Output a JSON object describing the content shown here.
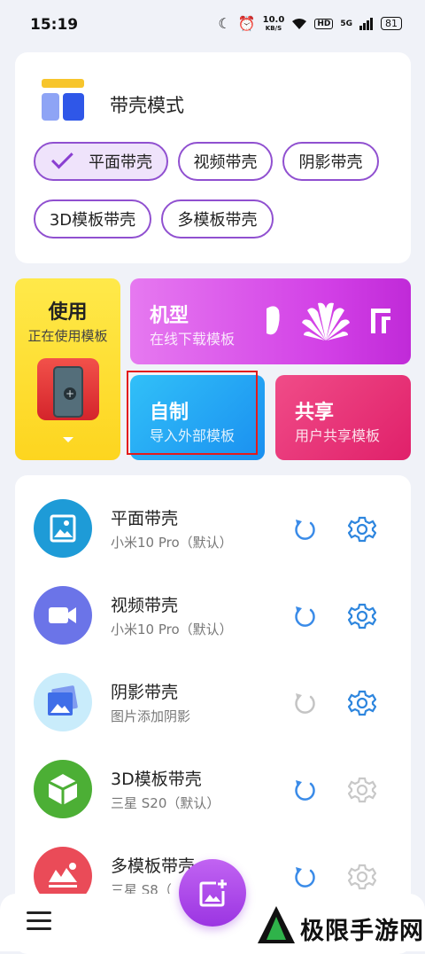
{
  "status_bar": {
    "time": "15:19",
    "network_speed": "10.0",
    "network_unit": "KB/S",
    "hd": "HD",
    "signal": "5G",
    "battery": "81",
    "icons": [
      "moon-icon",
      "alarm-icon",
      "wifi-icon",
      "signal-icon",
      "battery-icon"
    ]
  },
  "mode_card": {
    "title": "带壳模式",
    "chips": [
      {
        "label": "平面带壳",
        "selected": true
      },
      {
        "label": "视频带壳",
        "selected": false
      },
      {
        "label": "阴影带壳",
        "selected": false
      },
      {
        "label": "3D模板带壳",
        "selected": false
      },
      {
        "label": "多模板带壳",
        "selected": false
      }
    ]
  },
  "tiles": {
    "use": {
      "title": "使用",
      "subtitle": "正在使用模板"
    },
    "model": {
      "title": "机型",
      "subtitle": "在线下载模板",
      "brands": [
        "apple-logo-icon",
        "huawei-logo-icon",
        "xiaomi-logo-icon"
      ]
    },
    "self_made": {
      "title": "自制",
      "subtitle": "导入外部模板"
    },
    "share": {
      "title": "共享",
      "subtitle": "用户共享模板"
    }
  },
  "list": [
    {
      "title": "平面带壳",
      "subtitle": "小米10 Pro（默认）",
      "icon": "image-icon",
      "icon_color": "#1e9bd7",
      "refresh_active": true,
      "settings_active": true
    },
    {
      "title": "视频带壳",
      "subtitle": "小米10 Pro（默认）",
      "icon": "video-icon",
      "icon_color": "#6b74e8",
      "refresh_active": true,
      "settings_active": true
    },
    {
      "title": "阴影带壳",
      "subtitle": "图片添加阴影",
      "icon": "shadow-image-icon",
      "icon_color": "#c9ecfb",
      "refresh_active": false,
      "settings_active": true
    },
    {
      "title": "3D模板带壳",
      "subtitle": "三星 S20（默认）",
      "icon": "cube-icon",
      "icon_color": "#4caf35",
      "refresh_active": true,
      "settings_active": false
    },
    {
      "title": "多模板带壳",
      "subtitle": "三星 S8（",
      "icon": "multi-image-icon",
      "icon_color": "#ea4b58",
      "refresh_active": true,
      "settings_active": false
    }
  ],
  "colors": {
    "accent": "#9050d0",
    "refresh_active": "#3a8be8",
    "refresh_inactive": "#c4c4c4",
    "gear_active": "#2e86de",
    "gear_inactive": "#c8c8c8"
  },
  "watermark": {
    "text": "极限手游网"
  }
}
